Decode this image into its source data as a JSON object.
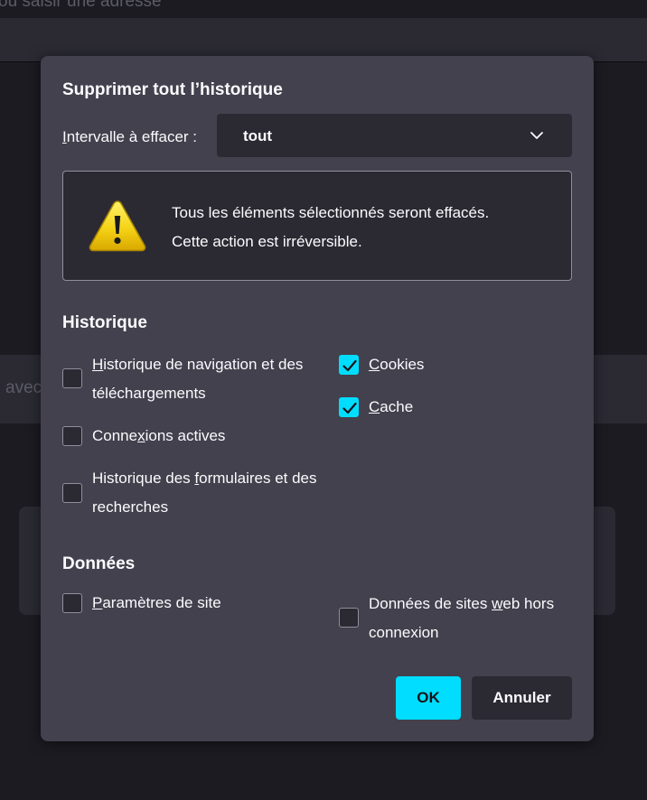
{
  "background": {
    "url_placeholder": "ou saisir une adresse",
    "search_fragment": "avec"
  },
  "dialog": {
    "title": "Supprimer tout l’historique",
    "range": {
      "label_accesskey": "I",
      "label_rest": "ntervalle à effacer :",
      "selected": "tout"
    },
    "warning": {
      "line1": "Tous les éléments sélectionnés seront effacés.",
      "line2": "Cette action est irréversible."
    },
    "history_section": {
      "title": "Historique",
      "items": [
        {
          "pre": "",
          "key": "H",
          "post": "istorique de navigation et des",
          "line2": "téléchargements",
          "checked": false
        },
        {
          "pre": "",
          "key": "C",
          "post": "ookies",
          "checked": true
        },
        {
          "pre": "",
          "key": "C",
          "post": "ache",
          "checked": true
        },
        {
          "pre": "Conne",
          "key": "x",
          "post": "ions actives",
          "checked": false
        },
        {
          "pre": "Historique des ",
          "key": "f",
          "post": "ormulaires et des",
          "line2": "recherches",
          "checked": false
        }
      ]
    },
    "data_section": {
      "title": "Données",
      "items": [
        {
          "pre": "",
          "key": "P",
          "post": "aramètres de site",
          "checked": false
        },
        {
          "pre": "Données de sites ",
          "key": "w",
          "post": "eb hors",
          "line2": "connexion",
          "checked": false
        }
      ]
    },
    "buttons": {
      "ok": "OK",
      "cancel": "Annuler"
    }
  },
  "colors": {
    "dialog_bg": "#42414d",
    "field_bg": "#2b2a33",
    "accent": "#00ddff",
    "text": "#fbfbfe"
  },
  "icons": {
    "select_arrow": "chevron-down-icon",
    "warning": "warning-icon",
    "checkmark": "checkmark-icon"
  }
}
